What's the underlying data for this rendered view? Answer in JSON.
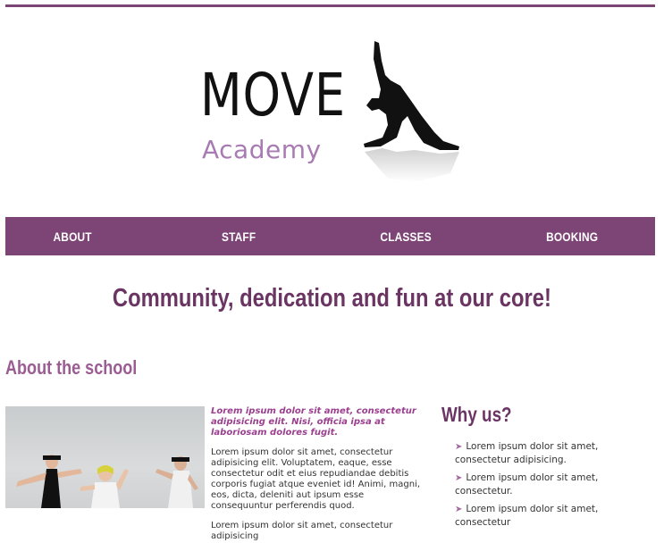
{
  "logo": {
    "title": "MOVE",
    "subtitle": "Academy"
  },
  "nav": {
    "items": [
      "ABOUT",
      "STAFF",
      "CLASSES",
      "BOOKING"
    ]
  },
  "tagline": "Community, dedication and fun at our core!",
  "about": {
    "title": "About the school",
    "lead": "Lorem ipsum dolor sit amet, consectetur adipisicing elit. Nisi, officia ipsa at laboriosam dolores fugit.",
    "paragraphs": [
      "Lorem ipsum dolor sit amet, consectetur adipisicing elit. Voluptatem, eaque, esse consectetur odit et eius repudiandae debitis corporis fugiat atque eveniet id! Animi, magni, eos, dicta, deleniti aut ipsum esse consequuntur perferendis quod.",
      "Lorem ipsum dolor sit amet, consectetur adipisicing"
    ]
  },
  "why": {
    "title": "Why us?",
    "items": [
      "Lorem ipsum dolor sit amet, consectetur adipisicing.",
      "Lorem ipsum dolor sit amet, consectetur.",
      "Lorem ipsum dolor sit amet, consectetur"
    ]
  },
  "colors": {
    "brand": "#7d4476",
    "accent": "#a87bb3",
    "heading": "#6b3563"
  }
}
